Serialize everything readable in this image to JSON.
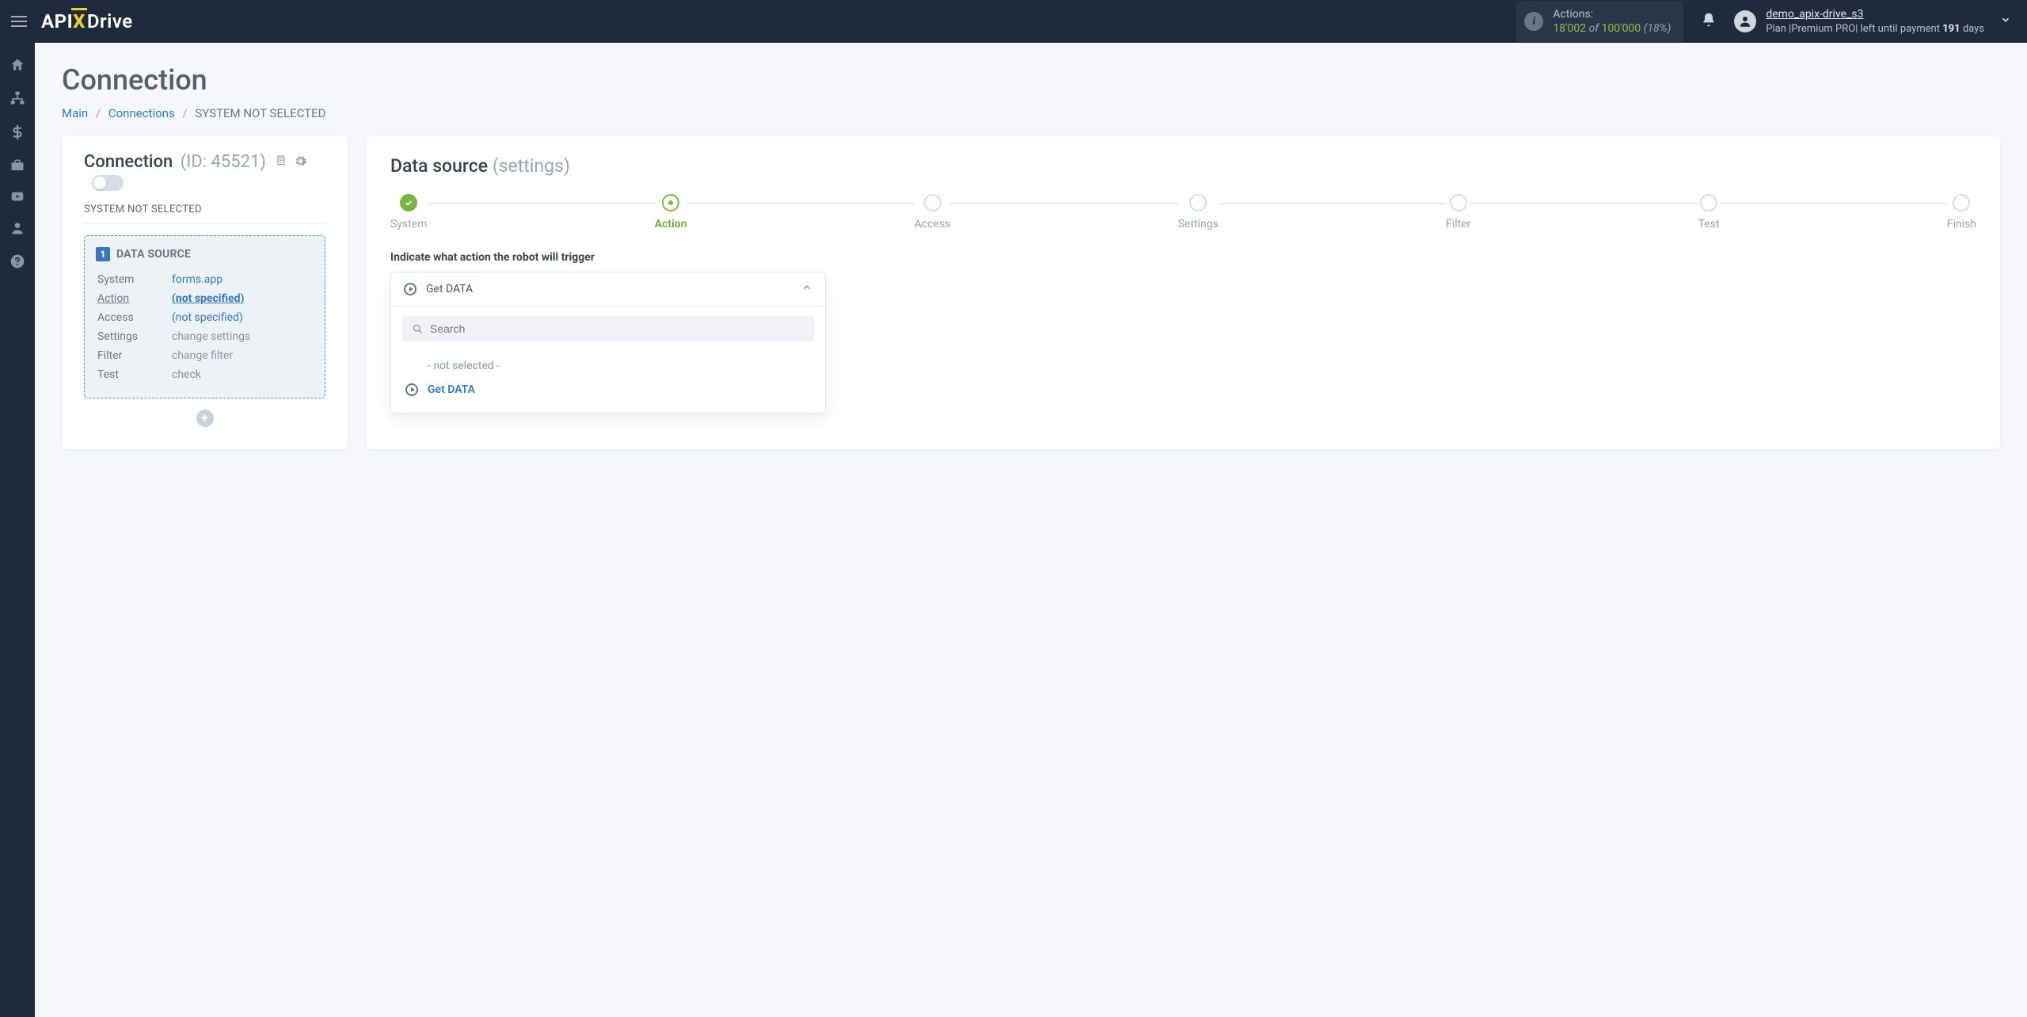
{
  "header": {
    "logo": {
      "part1": "API",
      "part2": "X",
      "part3": "Drive"
    },
    "actions": {
      "label": "Actions:",
      "used": "18'002",
      "of": "of",
      "total": "100'000",
      "pct": "(18%)"
    },
    "user": {
      "name": "demo_apix-drive_s3",
      "plan_prefix": "Plan |",
      "plan_name": "Premium PRO",
      "plan_mid": "| left until payment ",
      "days": "191",
      "days_suffix": " days"
    }
  },
  "sidebar": {
    "items": [
      {
        "name": "home-icon"
      },
      {
        "name": "sitemap-icon"
      },
      {
        "name": "dollar-icon"
      },
      {
        "name": "briefcase-icon"
      },
      {
        "name": "youtube-icon"
      },
      {
        "name": "user-icon"
      },
      {
        "name": "help-icon"
      }
    ]
  },
  "page": {
    "title": "Connection",
    "breadcrumb": {
      "main": "Main",
      "connections": "Connections",
      "current": "SYSTEM NOT SELECTED"
    }
  },
  "left": {
    "heading": "Connection",
    "id_label": "(ID: 45521)",
    "subheader": "SYSTEM NOT SELECTED",
    "ds_title": "DATA SOURCE",
    "rows": [
      {
        "k": "System",
        "v": "forms.app",
        "type": "link"
      },
      {
        "k": "Action",
        "v": "(not specified)",
        "type": "active"
      },
      {
        "k": "Access",
        "v": "(not specified)",
        "type": "link"
      },
      {
        "k": "Settings",
        "v": "change settings",
        "type": "muted"
      },
      {
        "k": "Filter",
        "v": "change filter",
        "type": "muted"
      },
      {
        "k": "Test",
        "v": "check",
        "type": "muted"
      }
    ]
  },
  "right": {
    "heading": "Data source",
    "heading_sub": "(settings)",
    "steps": [
      {
        "label": "System",
        "state": "done"
      },
      {
        "label": "Action",
        "state": "active"
      },
      {
        "label": "Access",
        "state": "pending"
      },
      {
        "label": "Settings",
        "state": "pending"
      },
      {
        "label": "Filter",
        "state": "pending"
      },
      {
        "label": "Test",
        "state": "pending"
      },
      {
        "label": "Finish",
        "state": "pending"
      }
    ],
    "instruction": "Indicate what action the robot will trigger",
    "dropdown": {
      "selected": "Get DATA",
      "search_placeholder": "Search",
      "options": [
        {
          "label": "- not selected -",
          "primary": false
        },
        {
          "label": "Get DATA",
          "primary": true
        }
      ]
    }
  }
}
